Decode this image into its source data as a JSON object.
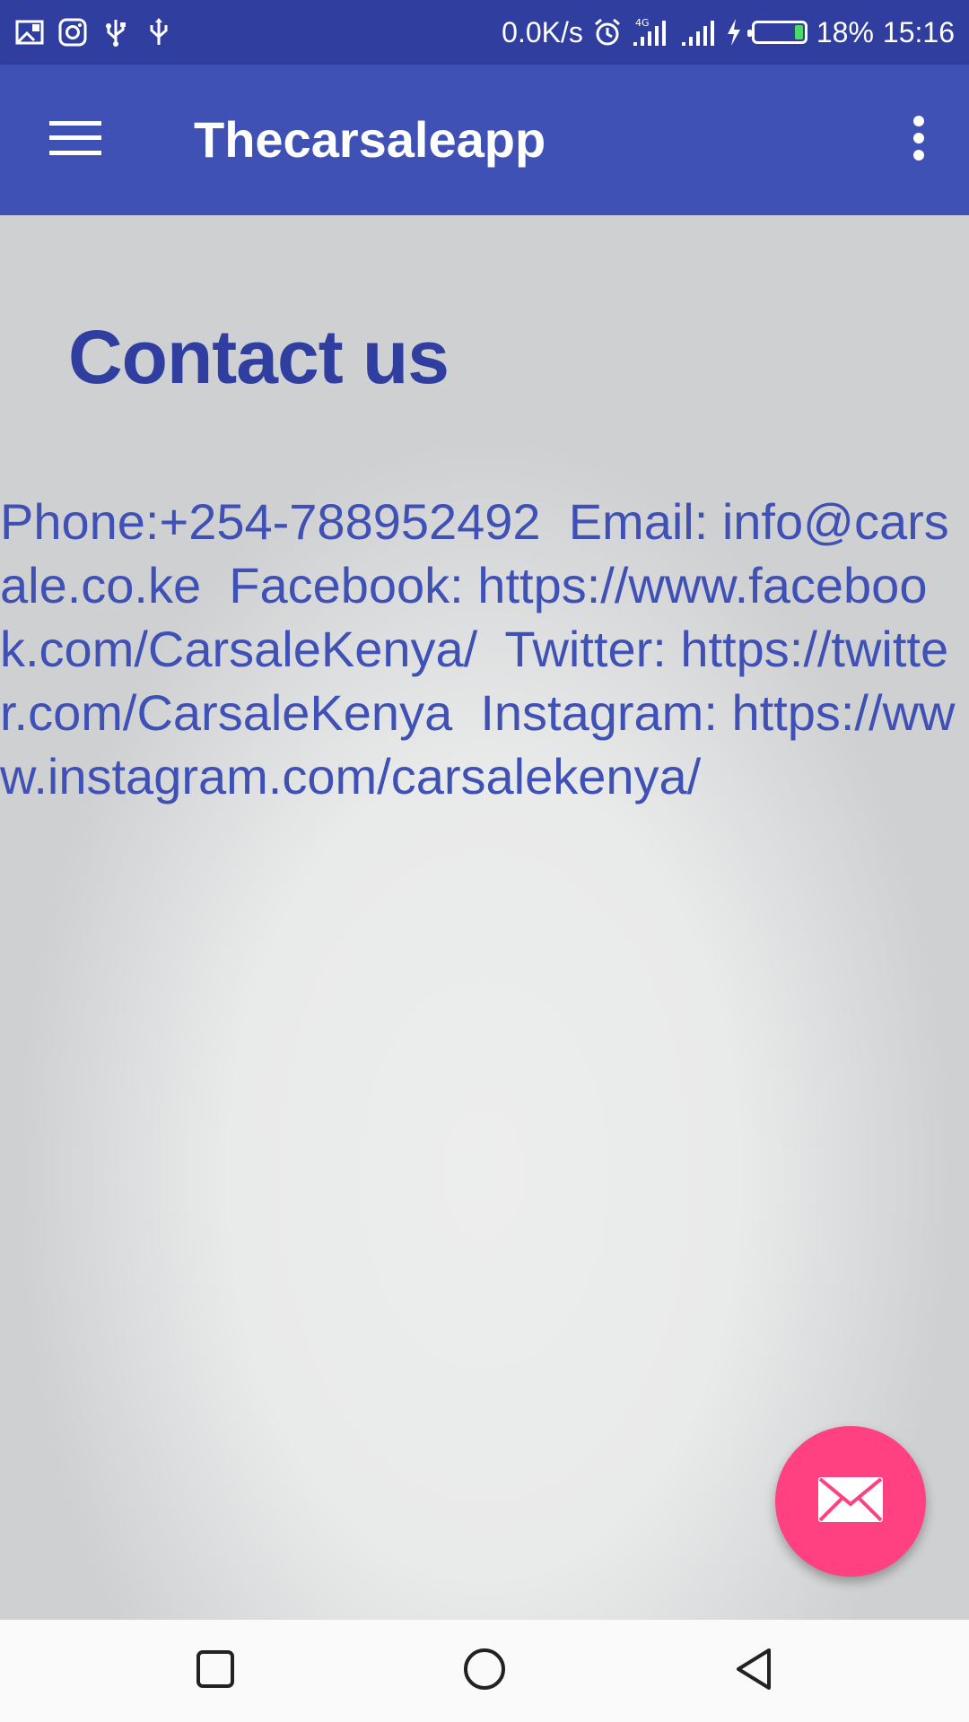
{
  "status_bar": {
    "network_speed": "0.0K/s",
    "network_type": "4G",
    "battery_percent": "18%",
    "battery_level": 0.18,
    "time": "15:16",
    "left_icons": [
      "picture-icon",
      "instagram-icon",
      "usb-icon",
      "usb-icon"
    ]
  },
  "app_bar": {
    "title": "Thecarsaleapp",
    "menu_icon": "hamburger-menu-icon",
    "overflow_icon": "more-vert-icon",
    "color": "#3f51b5"
  },
  "content": {
    "heading": "Contact us",
    "contact_text": "Phone:+254-788952492  Email: info@carsale.co.ke  Facebook: https://www.facebook.com/CarsaleKenya/  Twitter: https://twitter.com/CarsaleKenya  Instagram: https://www.instagram.com/carsalekenya/"
  },
  "fab": {
    "icon": "envelope-icon",
    "color": "#ff4081"
  },
  "nav_bar": {
    "buttons": [
      "recent-apps-icon",
      "home-icon",
      "back-icon"
    ]
  }
}
